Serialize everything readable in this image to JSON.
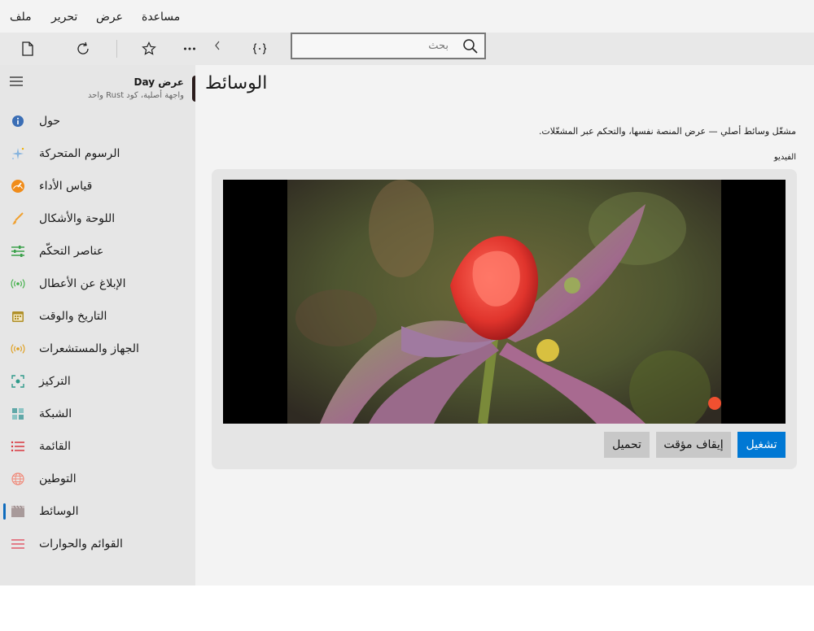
{
  "menubar": {
    "items": [
      "ملف",
      "تحرير",
      "عرض",
      "مساعدة"
    ]
  },
  "toolbar": {
    "search": {
      "placeholder": "بحث",
      "value": ""
    },
    "icons": [
      "new-document-icon",
      "refresh-icon",
      "star-icon",
      "more-icon",
      "chevron-left-icon",
      "code-braces-icon",
      "search-icon"
    ]
  },
  "sidebar": {
    "app_name": "عرض Day",
    "app_tagline": "واجهة أصلية، كود Rust واحد",
    "items": [
      {
        "label": "حول",
        "icon": "info-icon",
        "color": "#3b6eb5"
      },
      {
        "label": "الرسوم المتحركة",
        "icon": "sparkle-icon",
        "color": "#6fa8dc"
      },
      {
        "label": "قياس الأداء",
        "icon": "gauge-icon",
        "color": "#f08c1a"
      },
      {
        "label": "اللوحة والأشكال",
        "icon": "brush-icon",
        "color": "#f0a030"
      },
      {
        "label": "عناصر التحكّم",
        "icon": "sliders-icon",
        "color": "#3aa04a"
      },
      {
        "label": "الإبلاغ عن الأعطال",
        "icon": "broadcast-icon",
        "color": "#43b04a"
      },
      {
        "label": "التاريخ والوقت",
        "icon": "calendar-icon",
        "color": "#b0902a"
      },
      {
        "label": "الجهاز والمستشعرات",
        "icon": "sensor-icon",
        "color": "#e0a020"
      },
      {
        "label": "التركيز",
        "icon": "focus-icon",
        "color": "#2f9a8a"
      },
      {
        "label": "الشبكة",
        "icon": "grid-icon",
        "color": "#60a8a8"
      },
      {
        "label": "القائمة",
        "icon": "list-icon",
        "color": "#d9363e"
      },
      {
        "label": "التوطين",
        "icon": "globe-icon",
        "color": "#f08a7a"
      },
      {
        "label": "الوسائط",
        "icon": "film-icon",
        "color": "#a89a9a",
        "selected": true
      },
      {
        "label": "القوائم والحوارات",
        "icon": "menu-lines-icon",
        "color": "#e05a6a"
      }
    ]
  },
  "main": {
    "title": "الوسائط",
    "description": "مشغّل وسائط أصلي — عرض المنصة نفسها، والتحكم عبر المشغّلات.",
    "video_label": "الفيديو",
    "buttons": {
      "play": "تشغيل",
      "pause": "إيقاف مؤقت",
      "load": "تحميل"
    }
  }
}
